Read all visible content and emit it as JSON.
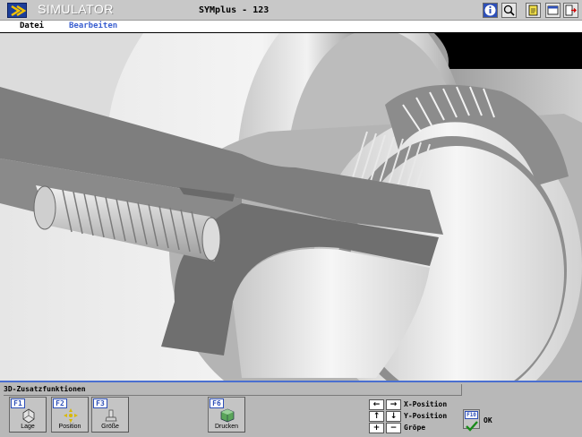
{
  "titlebar": {
    "app_title": "SIMULATOR",
    "doc_title": "SYMplus - 123",
    "buttons": [
      "info-icon",
      "help-magnifier-icon",
      "notepad-icon",
      "window-icon",
      "exit-icon"
    ]
  },
  "menu": {
    "datei": "Datei",
    "bearbeiten": "Bearbeiten"
  },
  "panel": {
    "title": "3D-Zusatzfunktionen",
    "fkeys": [
      {
        "key": "F1",
        "label": "Lage",
        "icon": "orientation-icon"
      },
      {
        "key": "F2",
        "label": "Position",
        "icon": "move-icon"
      },
      {
        "key": "F3",
        "label": "Größe",
        "icon": "size-icon"
      },
      {
        "key": "F6",
        "label": "Drucken",
        "icon": "print-cube-icon"
      }
    ],
    "x_position": "X-Position",
    "y_position": "Y-Position",
    "groesse": "Gröpe",
    "arrows": {
      "left": "←",
      "right": "→",
      "up": "↑",
      "down": "↓",
      "plus": "+",
      "minus": "−"
    },
    "ok_key": "F10",
    "ok_label": "OK"
  },
  "colors": {
    "panel_border": "#4a6fd0",
    "fkey_blue": "#2d4fb8",
    "menu_active": "#3a5fd0"
  }
}
